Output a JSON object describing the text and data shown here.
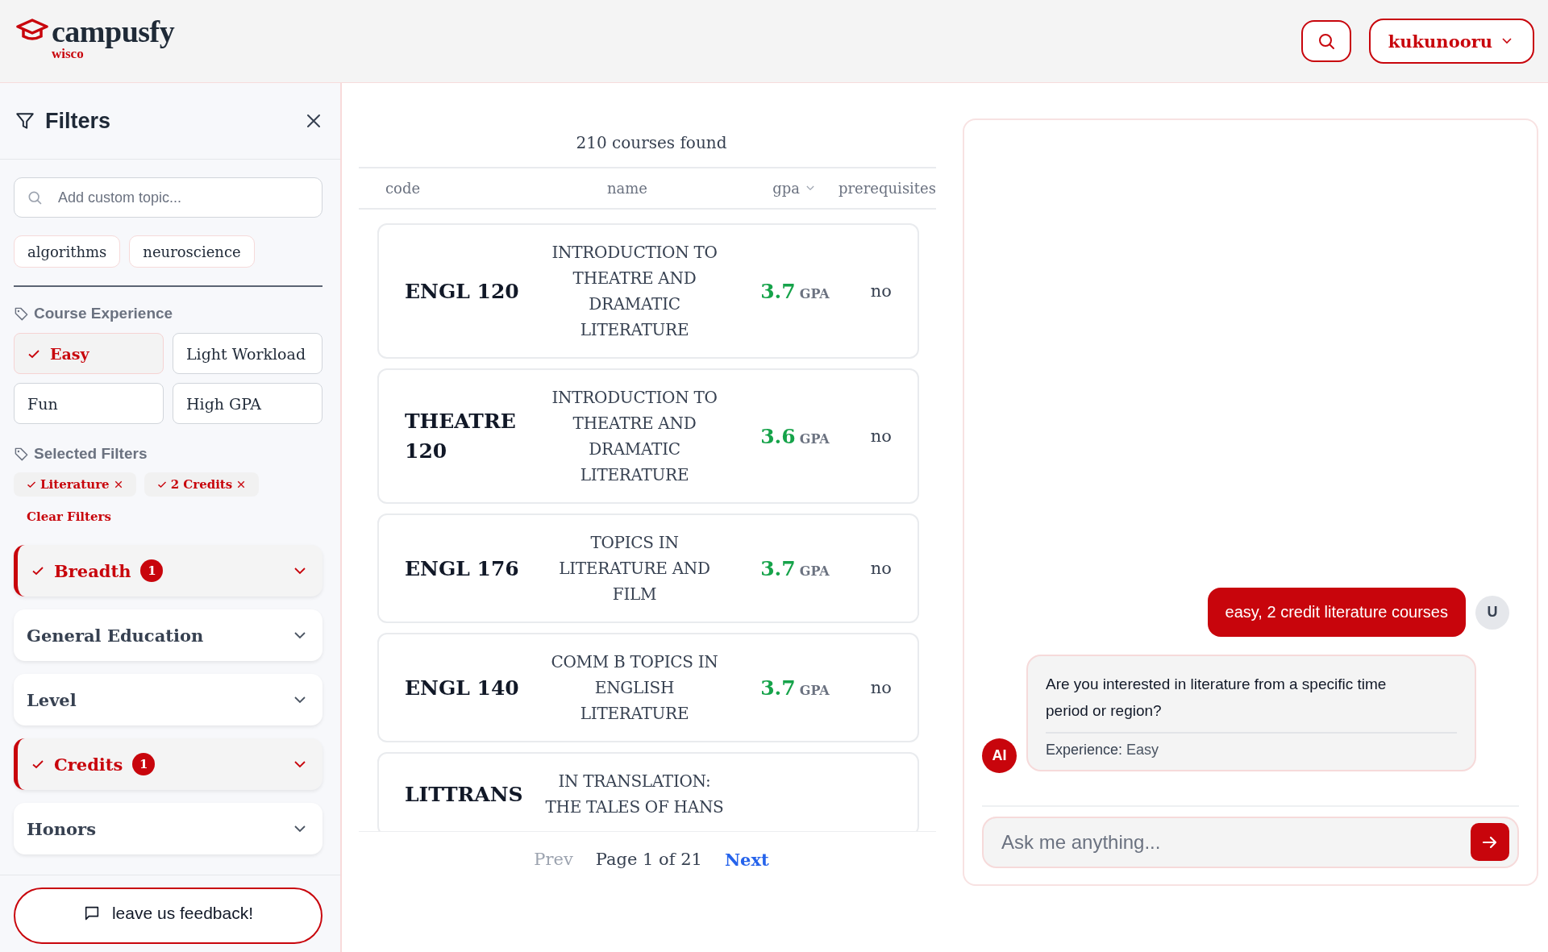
{
  "header": {
    "logo": {
      "name": "campusfy",
      "tag": "wisco"
    },
    "user": "kukunooru"
  },
  "filters": {
    "title": "Filters",
    "topic_search": {
      "placeholder": "Add custom topic..."
    },
    "topics": [
      "algorithms",
      "neuroscience"
    ],
    "experience": {
      "title": "Course Experience",
      "options": [
        {
          "label": "Easy",
          "selected": true
        },
        {
          "label": "Light Workload",
          "selected": false
        },
        {
          "label": "Fun",
          "selected": false
        },
        {
          "label": "High GPA",
          "selected": false
        }
      ]
    },
    "selected": {
      "title": "Selected Filters",
      "chips": [
        "Literature",
        "2 Credits"
      ],
      "clear": "Clear Filters"
    },
    "sections": [
      {
        "label": "Breadth",
        "active": true,
        "count": "1"
      },
      {
        "label": "General Education",
        "active": false
      },
      {
        "label": "Level",
        "active": false
      },
      {
        "label": "Credits",
        "active": true,
        "count": "1"
      },
      {
        "label": "Honors",
        "active": false
      }
    ],
    "feedback": "leave us feedback!"
  },
  "results": {
    "count": "210 courses found",
    "columns": [
      "code",
      "name",
      "gpa",
      "prerequisites"
    ],
    "rows": [
      {
        "code": "ENGL 120",
        "name": [
          "INTRODUCTION TO",
          "THEATRE AND",
          "DRAMATIC",
          "LITERATURE"
        ],
        "gpa": "3.7",
        "gpa_unit": "GPA",
        "prerequisites": "no"
      },
      {
        "code": "THEATRE 120",
        "name": [
          "INTRODUCTION TO",
          "THEATRE AND",
          "DRAMATIC",
          "LITERATURE"
        ],
        "gpa": "3.6",
        "gpa_unit": "GPA",
        "prerequisites": "no"
      },
      {
        "code": "ENGL 176",
        "name": [
          "TOPICS IN",
          "LITERATURE AND",
          "FILM"
        ],
        "gpa": "3.7",
        "gpa_unit": "GPA",
        "prerequisites": "no"
      },
      {
        "code": "ENGL 140",
        "name": [
          "COMM B TOPICS IN",
          "ENGLISH",
          "LITERATURE"
        ],
        "gpa": "3.7",
        "gpa_unit": "GPA",
        "prerequisites": "no"
      },
      {
        "code": "LITTRANS",
        "name": [
          "IN TRANSLATION:",
          "THE TALES OF HANS"
        ]
      }
    ],
    "pagination": {
      "prev": "Prev",
      "page": "Page 1 of 21",
      "next": "Next"
    }
  },
  "chat": {
    "messages": [
      {
        "kind": "user",
        "avatar": "U",
        "text": "easy, 2 credit literature courses"
      },
      {
        "kind": "assistant",
        "avatar": "AI",
        "text": "Are you interested in literature from a specific time period or region?",
        "meta_label": "Experience:",
        "meta_value": "Easy"
      }
    ],
    "input": {
      "placeholder": "Ask me anything..."
    }
  }
}
